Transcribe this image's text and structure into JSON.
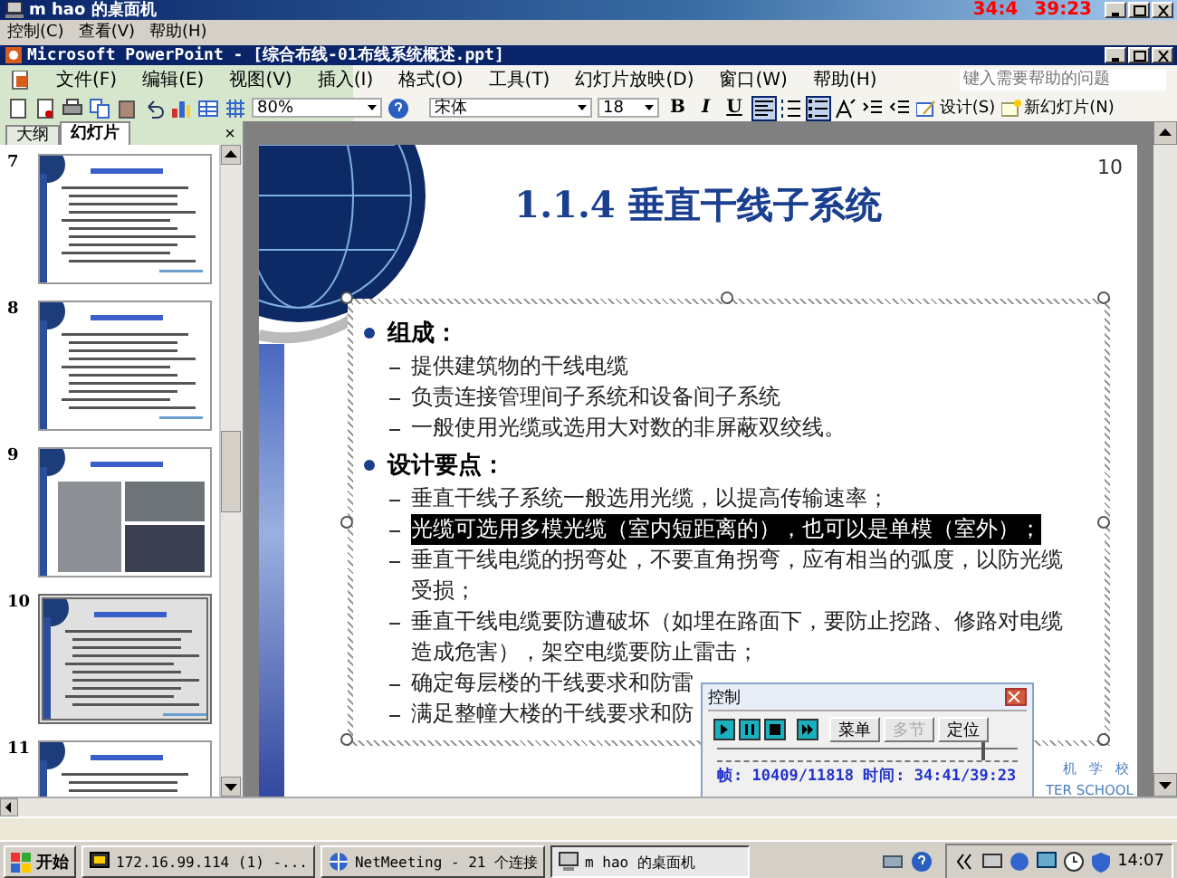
{
  "remote_window": {
    "title": "m hao 的桌面机",
    "overlay_time": [
      "34:4",
      "39:23"
    ],
    "menu": [
      "控制(C)",
      "查看(V)",
      "帮助(H)"
    ]
  },
  "app": {
    "title": "Microsoft PowerPoint - [综合布线-01布线系统概述.ppt]",
    "menu": [
      "文件(F)",
      "编辑(E)",
      "视图(V)",
      "插入(I)",
      "格式(O)",
      "工具(T)",
      "幻灯片放映(D)",
      "窗口(W)",
      "帮助(H)"
    ],
    "help_placeholder": "键入需要帮助的问题"
  },
  "toolbar": {
    "zoom": "80%",
    "font": "宋体",
    "size": "18",
    "text_style": [
      {
        "label": "B",
        "pressed": false
      },
      {
        "label": "I",
        "pressed": false
      },
      {
        "label": "U",
        "pressed": false
      }
    ],
    "toggles": [
      {
        "kind": "align-left",
        "pressed": true
      },
      {
        "kind": "numbering",
        "pressed": false
      },
      {
        "kind": "bullets",
        "pressed": true
      }
    ],
    "design": "设计(S)",
    "new_slide": "新幻灯片(N)"
  },
  "pane": {
    "tabs": [
      {
        "label": "大纲",
        "selected": false
      },
      {
        "label": "幻灯片",
        "selected": true
      }
    ],
    "close": "×",
    "thumbnails": [
      {
        "number": "7",
        "kind": "text",
        "selected": false
      },
      {
        "number": "8",
        "kind": "text",
        "selected": false
      },
      {
        "number": "9",
        "kind": "photos",
        "selected": false
      },
      {
        "number": "10",
        "kind": "text",
        "selected": true
      },
      {
        "number": "11",
        "kind": "text",
        "selected": false
      }
    ]
  },
  "slide": {
    "number": "10",
    "title": "1.1.4 垂直干线子系统",
    "bullets": [
      {
        "text": "组成：",
        "children": [
          {
            "text": "提供建筑物的干线电缆",
            "selected": false
          },
          {
            "text": "负责连接管理间子系统和设备间子系统",
            "selected": false
          },
          {
            "text": "一般使用光缆或选用大对数的非屏蔽双绞线。",
            "selected": false
          }
        ]
      },
      {
        "text": "设计要点：",
        "children": [
          {
            "text": "垂直干线子系统一般选用光缆，以提高传输速率；",
            "selected": false
          },
          {
            "text": "光缆可选用多模光缆（室内短距离的），也可以是单模（室外）；",
            "selected": true
          },
          {
            "text": "垂直干线电缆的拐弯处，不要直角拐弯，应有相当的弧度，以防光缆受损；",
            "selected": false
          },
          {
            "text": "垂直干线电缆要防遭破坏（如埋在路面下，要防止挖路、修路对电缆造成危害），架空电缆要防止雷击；",
            "selected": false
          },
          {
            "text": "确定每层楼的干线要求和防雷",
            "selected": false
          },
          {
            "text": "满足整幢大楼的干线要求和防",
            "selected": false
          }
        ]
      }
    ],
    "footer": [
      "机 学 校",
      "TER SCHOOL"
    ]
  },
  "player": {
    "title": "控制",
    "buttons": [
      {
        "label": "菜单",
        "disabled": false
      },
      {
        "label": "多节",
        "disabled": true
      },
      {
        "label": "定位",
        "disabled": false
      }
    ],
    "level": 0.88,
    "status": "帧: 10409/11818 时间: 34:41/39:23"
  },
  "taskbar": {
    "start": "开始",
    "tasks": [
      {
        "label": "172.16.99.114 (1) -...",
        "selected": false
      },
      {
        "label": "NetMeeting - 21 个连接",
        "selected": false
      },
      {
        "label": "m hao 的桌面机",
        "selected": true
      }
    ],
    "clock": "14:07"
  }
}
